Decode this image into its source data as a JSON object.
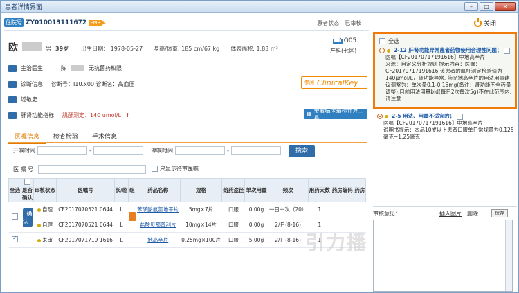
{
  "window": {
    "title": "患者详情界面"
  },
  "header": {
    "hosp_tag": "住院号",
    "patient_id": "ZY010013111672",
    "emr": "EMR",
    "status_label": "患者状态",
    "status_value": "已审核",
    "close_label": "关闭"
  },
  "patient": {
    "surname": "欧",
    "gender": "男",
    "age": "39岁",
    "birth": "出生日期：  1978-05-27",
    "height_weight": "身高/体重: 185 cm/67 kg",
    "bsa": "体表面积:  1.83 m²",
    "bed_no": "NO05",
    "ward": "产科(七区)"
  },
  "rows": {
    "doctor_label": "主治医生",
    "doctor_name": "陈",
    "doctor_right": "无抗菌药权限",
    "diag_label": "诊断信息",
    "diag_code": "诊断号：I10.x00  诊断名：高血压",
    "allergy": "过敏史",
    "liver_label": "肝肾功能指标",
    "liver_value": "肌酐测定：140 umol/L"
  },
  "clinical": {
    "prefix": "参阅",
    "name": "ClinicalKey"
  },
  "tool_button": "患者临床指标计算工具",
  "tabs": [
    "医嘱信息",
    "检查检验",
    "手术信息"
  ],
  "filter": {
    "start_label": "开嘱时间",
    "stop_label": "停嘱时间",
    "search": "搜索",
    "order_label": "医 嘱 号",
    "only_pending": "只显示待审医嘱"
  },
  "table": {
    "headers": [
      "全选",
      "是否确认",
      "审核状态",
      "医嘱号",
      "长/临",
      "组",
      "药品名称",
      "规格",
      "给药途径",
      "单次用量",
      "频次",
      "用药天数",
      "药房编码",
      "药房"
    ],
    "confirm": "确认",
    "rows": [
      {
        "status": "自理",
        "order": "CF2017070521 0644",
        "type": "L",
        "drug": "苯磺酸氨氯地平片",
        "spec": "5mg×7片",
        "route": "口服",
        "dose": "0.00g",
        "freq": "一日一次（20）",
        "days": "1"
      },
      {
        "status": "自理",
        "order": "CF2017070521 0644",
        "type": "L",
        "drug": "盐酸贝那普利片",
        "spec": "10mg×14片",
        "route": "口服",
        "dose": "0.00g",
        "freq": "2/日(8-16)",
        "days": "1"
      },
      {
        "status": "未审",
        "order": "CF2017071719 1616",
        "type": "L",
        "drug": "地高辛片",
        "spec": "0.25mg×100片",
        "route": "口服",
        "dose": "5.00g",
        "freq": "2/日(8-16)",
        "days": "1"
      }
    ]
  },
  "right_panel": {
    "select_all": "全选",
    "q1_title": "2-12 肝肾功能异常患者药物使用合理性问题；",
    "q1_order": "医嘱【CF20170717191616】中地高辛片",
    "q1_text": "来源：自定义分析规则  提示内容：医嘱：CF20170717191616 该患者的肌酐测定检验值为140μmol/L，肾功能异常, 药品地高辛片的用法用量建议调整为：单次量0.1-0.15mg(备注：肾功能不全药量调整),目前用法用量bid(每日2次每次5g)不在此范围内,请注意.",
    "q2_title": "2-5 用法、用量不适宜的；",
    "q2_order": "医嘱【CF20170717191616】中地高辛片",
    "q2_text": "说明书提示：本品10岁以上患者口服单日常规量为0.125毫克~1.25毫克",
    "review_label": "审核意见：",
    "insert_image": "插入图片",
    "delete": "删除",
    "save": "保存"
  },
  "watermark": "引力播"
}
